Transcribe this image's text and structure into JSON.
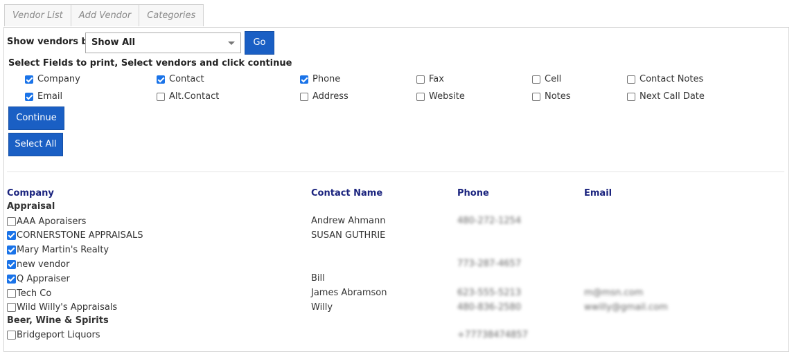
{
  "tabs": [
    {
      "label": "Vendor List"
    },
    {
      "label": "Add Vendor"
    },
    {
      "label": "Categories"
    }
  ],
  "filter": {
    "label": "Show vendors by",
    "selected": "Show All",
    "go_label": "Go"
  },
  "instructions": "Select Fields to print, Select vendors and click continue",
  "fields": [
    {
      "label": "Company",
      "checked": true
    },
    {
      "label": "Contact",
      "checked": true
    },
    {
      "label": "Phone",
      "checked": true
    },
    {
      "label": "Fax",
      "checked": false
    },
    {
      "label": "Cell",
      "checked": false
    },
    {
      "label": "Contact Notes",
      "checked": false
    },
    {
      "label": "Email",
      "checked": true
    },
    {
      "label": "Alt.Contact",
      "checked": false
    },
    {
      "label": "Address",
      "checked": false
    },
    {
      "label": "Website",
      "checked": false
    },
    {
      "label": "Notes",
      "checked": false
    },
    {
      "label": "Next Call Date",
      "checked": false
    }
  ],
  "buttons": {
    "continue_label": "Continue",
    "select_all_label": "Select All"
  },
  "table": {
    "headers": {
      "company": "Company",
      "contact": "Contact Name",
      "phone": "Phone",
      "email": "Email"
    },
    "categories": [
      {
        "name": "Appraisal",
        "vendors": [
          {
            "company": "AAA Aporaisers",
            "checked": false,
            "contact": "Andrew Ahmann",
            "phone": "480-272-1254",
            "email": ""
          },
          {
            "company": "CORNERSTONE APPRAISALS",
            "checked": true,
            "contact": "SUSAN GUTHRIE",
            "phone": "",
            "email": ""
          },
          {
            "company": "Mary Martin's Realty",
            "checked": true,
            "contact": "",
            "phone": "",
            "email": ""
          },
          {
            "company": "new vendor",
            "checked": true,
            "contact": "",
            "phone": "773-287-4657",
            "email": ""
          },
          {
            "company": "Q Appraiser",
            "checked": true,
            "contact": "Bill",
            "phone": "",
            "email": ""
          },
          {
            "company": "Tech Co",
            "checked": false,
            "contact": "James Abramson",
            "phone": "623-555-5213",
            "email": "m@msn.com"
          },
          {
            "company": "Wild Willy's Appraisals",
            "checked": false,
            "contact": "Willy",
            "phone": "480-836-2580",
            "email": "wwilly@gmail.com"
          }
        ]
      },
      {
        "name": "Beer, Wine & Spirits",
        "vendors": [
          {
            "company": "Bridgeport Liquors",
            "checked": false,
            "contact": "",
            "phone": "+77738474857",
            "email": ""
          }
        ]
      }
    ]
  }
}
